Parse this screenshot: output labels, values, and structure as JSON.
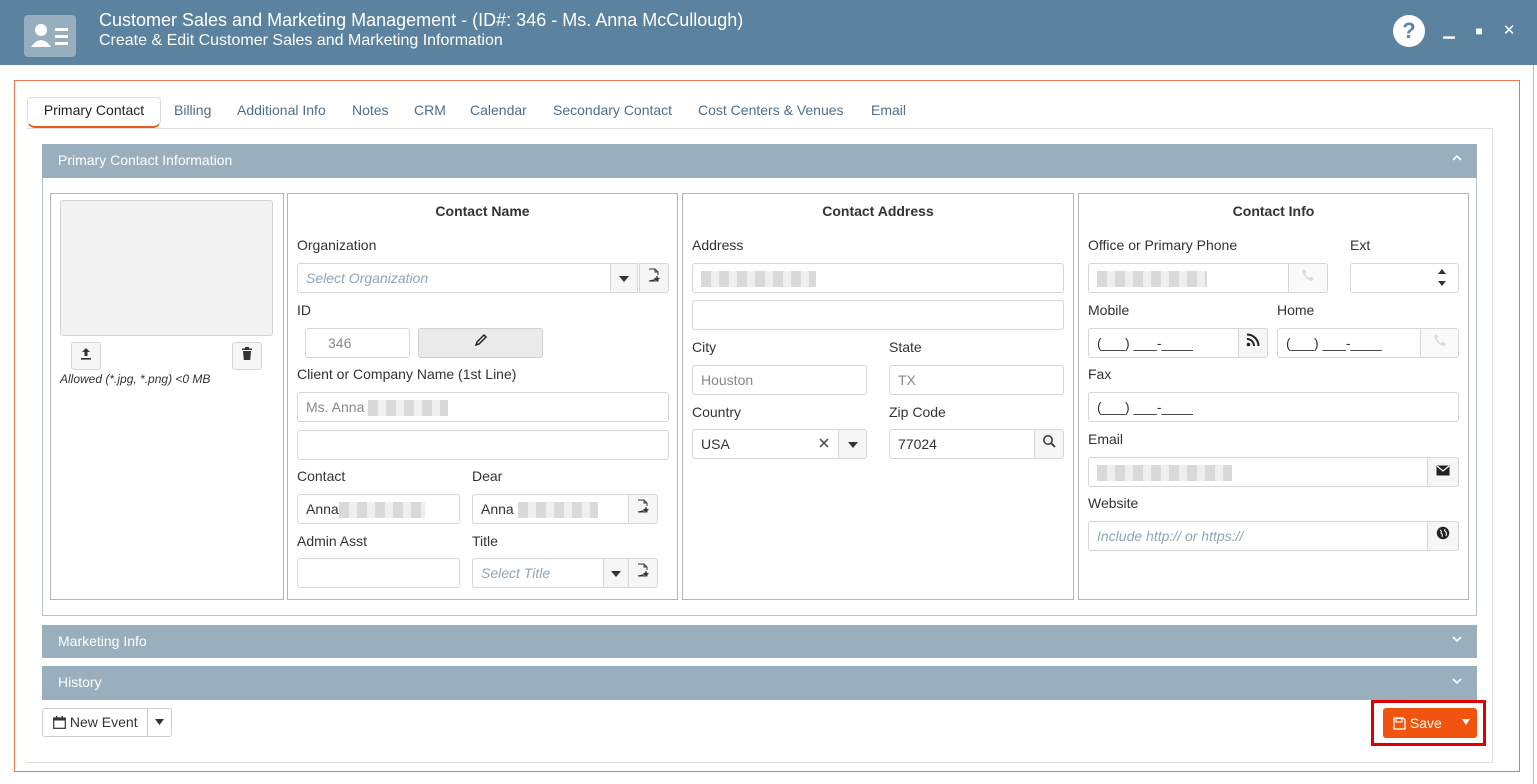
{
  "window": {
    "title": "Customer Sales and Marketing Management - (ID#: 346 - Ms. Anna McCullough)",
    "subtitle": "Create & Edit Customer Sales and Marketing Information",
    "help_label": "?",
    "minimize_label": "▁",
    "maximize_label": "■",
    "close_label": "✕"
  },
  "tabs": [
    {
      "label": "Primary Contact"
    },
    {
      "label": "Billing"
    },
    {
      "label": "Additional Info"
    },
    {
      "label": "Notes"
    },
    {
      "label": "CRM"
    },
    {
      "label": "Calendar"
    },
    {
      "label": "Secondary Contact"
    },
    {
      "label": "Cost Centers & Venues"
    },
    {
      "label": "Email"
    }
  ],
  "primary_panel": {
    "title": "Primary Contact Information",
    "allowed_text": "Allowed (*.jpg, *.png) <0 MB"
  },
  "contact_name": {
    "title": "Contact Name",
    "organization_label": "Organization",
    "organization_placeholder": "Select Organization",
    "id_label": "ID",
    "id_value": "346",
    "company_label": "Client or Company Name (1st Line)",
    "company_value": "Ms. Anna",
    "contact_label": "Contact",
    "contact_value": "Anna",
    "dear_label": "Dear",
    "dear_value": "Anna",
    "admin_label": "Admin Asst",
    "title_label": "Title",
    "title_placeholder": "Select Title"
  },
  "contact_address": {
    "title": "Contact Address",
    "address_label": "Address",
    "city_label": "City",
    "city_value": "Houston",
    "state_label": "State",
    "state_value": "TX",
    "country_label": "Country",
    "country_value": "USA",
    "zip_label": "Zip Code",
    "zip_value": "77024"
  },
  "contact_info": {
    "title": "Contact Info",
    "office_label": "Office or Primary Phone",
    "ext_label": "Ext",
    "mobile_label": "Mobile",
    "mobile_value": "(___) ___-____",
    "home_label": "Home",
    "home_value": "(___) ___-____",
    "fax_label": "Fax",
    "fax_value": "(___) ___-____",
    "email_label": "Email",
    "website_label": "Website",
    "website_placeholder": "Include http:// or https://"
  },
  "panels": {
    "marketing": "Marketing Info",
    "history": "History"
  },
  "footer": {
    "new_event_label": "New Event",
    "save_label": "Save"
  },
  "colors": {
    "titlebar": "#5b829e",
    "panel_header": "#9aafbe",
    "accent": "#f0540e"
  }
}
